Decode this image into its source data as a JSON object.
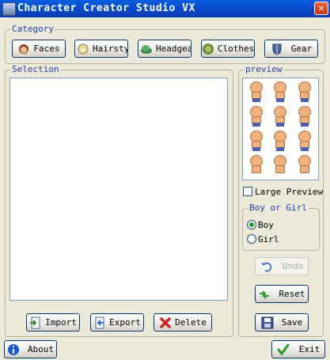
{
  "window": {
    "title": "Character Creator Studio VX",
    "close_glyph": "✕"
  },
  "category": {
    "label": "Category",
    "buttons": [
      {
        "label": "Faces",
        "icon": "face-icon"
      },
      {
        "label": "Hairstyle",
        "icon": "hair-icon"
      },
      {
        "label": "Headgear",
        "icon": "headgear-icon"
      },
      {
        "label": "Clothes",
        "icon": "clothes-icon"
      },
      {
        "label": "Gear",
        "icon": "shield-icon"
      }
    ]
  },
  "selection": {
    "label": "Selection",
    "import_label": "Import",
    "export_label": "Export",
    "delete_label": "Delete"
  },
  "preview": {
    "label": "preview",
    "large_preview_label": "Large Preview",
    "large_preview_checked": false
  },
  "gender": {
    "label": "Boy or Girl",
    "options": [
      {
        "label": "Boy",
        "checked": true
      },
      {
        "label": "Girl",
        "checked": false
      }
    ]
  },
  "actions": {
    "undo_label": "Undo",
    "undo_enabled": false,
    "reset_label": "Reset",
    "save_label": "Save"
  },
  "footer": {
    "about_label": "About",
    "exit_label": "Exit"
  },
  "colors": {
    "title_bar": "#0a5ee0",
    "group_label": "#1c3fb0",
    "background": "#ece9d8"
  }
}
